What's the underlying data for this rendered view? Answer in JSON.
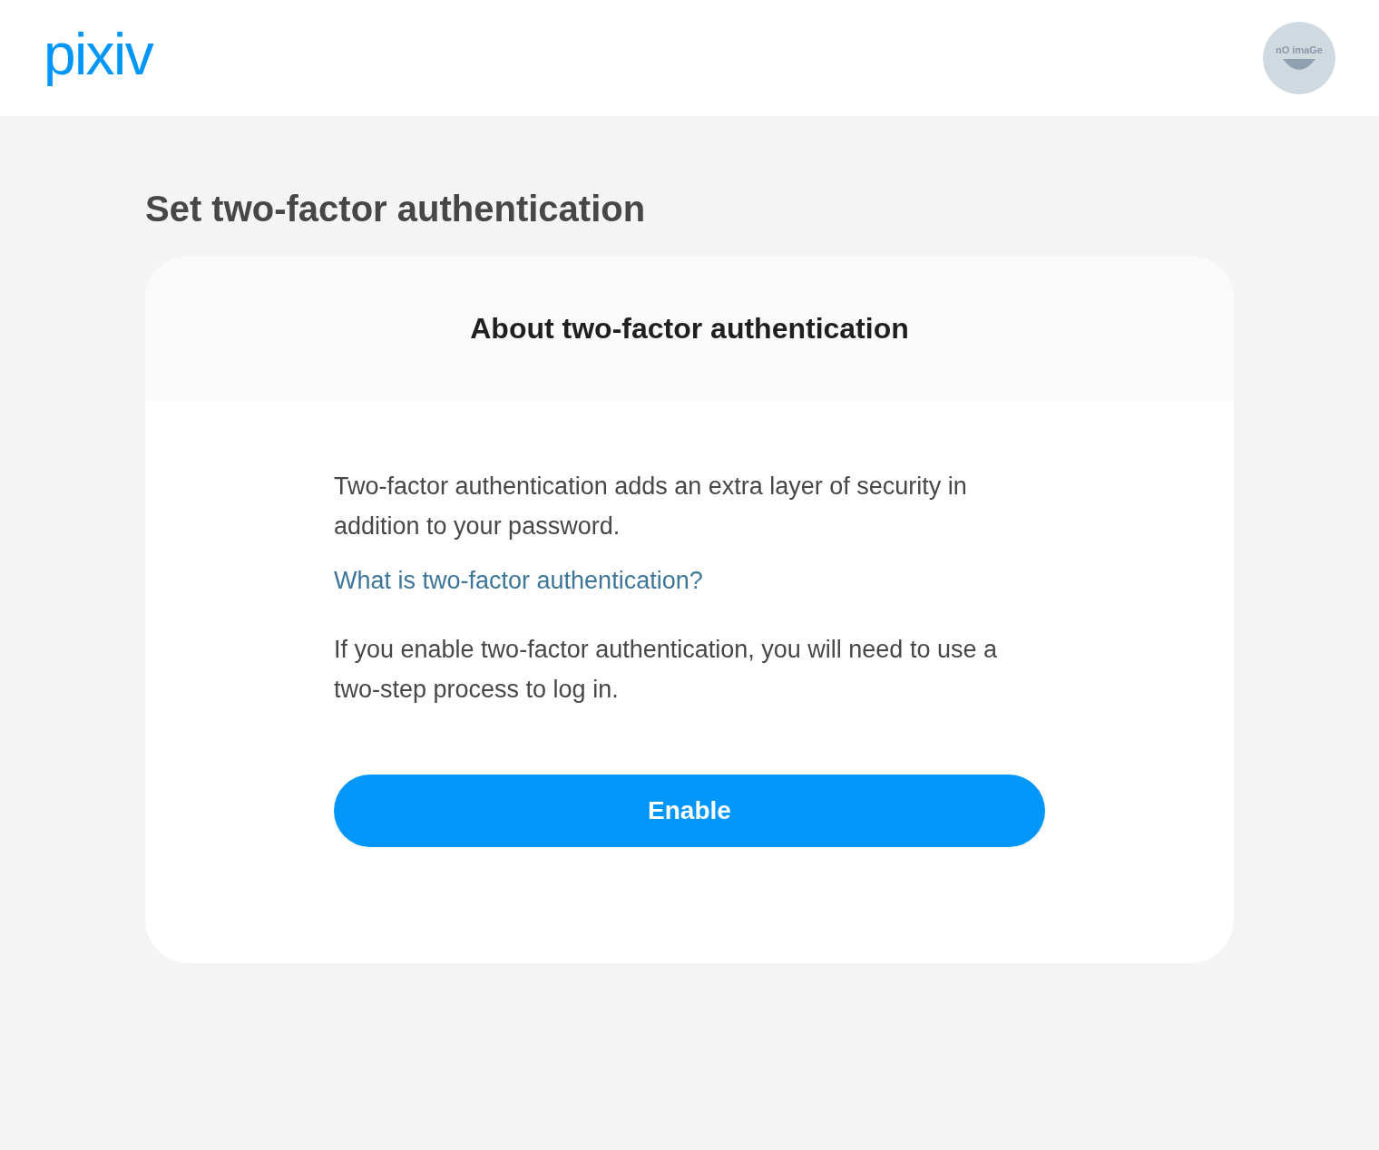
{
  "header": {
    "logo": "pixiv",
    "avatar_text": "nO imaGe"
  },
  "page_title": "Set two-factor authentication",
  "card": {
    "heading": "About two-factor authentication",
    "paragraphs": [
      {
        "kind": "text",
        "text": "Two-factor authentication adds an extra layer of security in addition to your password."
      },
      {
        "kind": "link",
        "text": "What is two-factor authentication?"
      },
      {
        "kind": "text",
        "text": "If you enable two-factor authentication, you will need to use a two-step process to log in."
      }
    ],
    "button": "Enable"
  }
}
